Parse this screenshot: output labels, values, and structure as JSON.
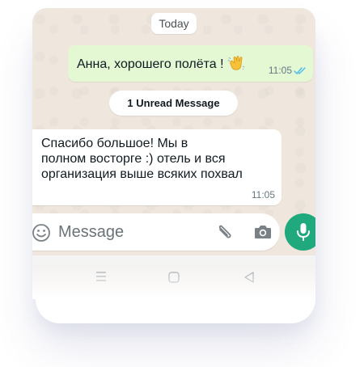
{
  "chat": {
    "date_label": "Today",
    "unread_label": "1 Unread Message",
    "outgoing": {
      "text": "Анна, хорошего полёта !",
      "time": "11:05",
      "emoji": "waving-hand-icon"
    },
    "incoming": {
      "lines": [
        "Спасибо большое! Мы в",
        "полном восторге :) отель и вся",
        "организация выше всяких похвал"
      ],
      "time": "11:05"
    }
  },
  "composer": {
    "placeholder": "Message"
  },
  "colors": {
    "outgoing_bubble": "#e4f8d4",
    "wallpaper": "#efe7de",
    "accent": "#1fa97c",
    "read_ticks": "#53bdeb"
  }
}
